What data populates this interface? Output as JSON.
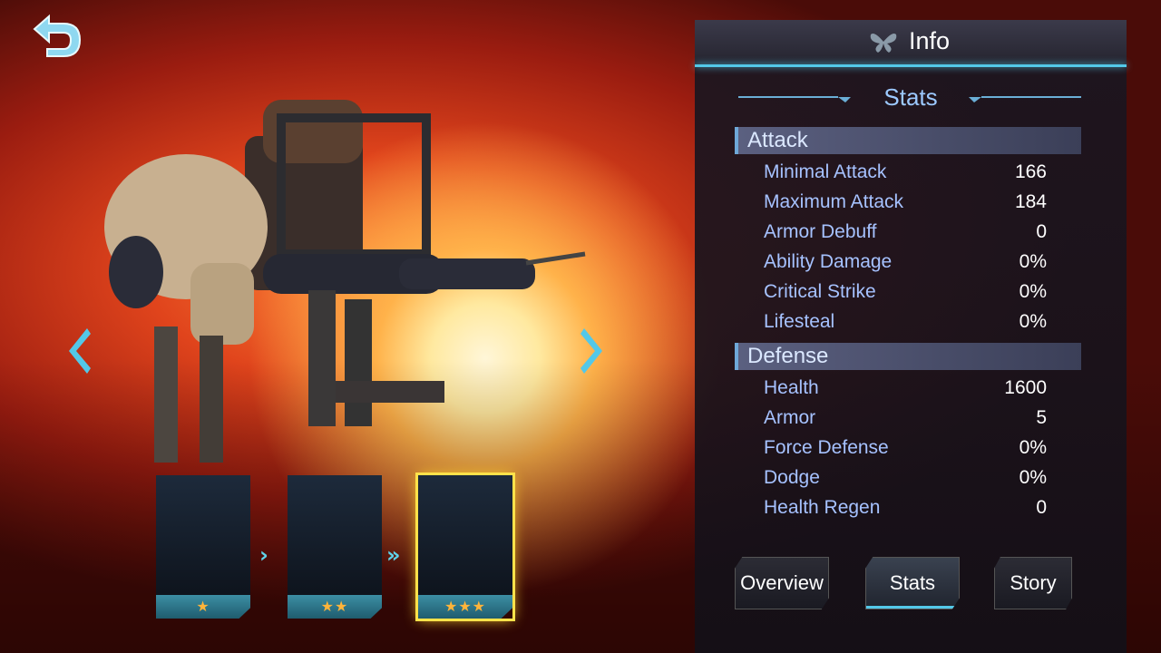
{
  "navigation": {
    "back_icon": "back-arrow-icon",
    "prev_icon": "chevron-left-icon",
    "next_icon": "chevron-right-icon"
  },
  "evolution": {
    "cards": [
      {
        "stars": "★",
        "selected": false
      },
      {
        "stars": "★★",
        "selected": false
      },
      {
        "stars": "★★★",
        "selected": true
      }
    ]
  },
  "panel": {
    "title": "Info",
    "title_icon": "butterfly-icon",
    "stats_heading": "Stats",
    "sections": [
      {
        "name": "Attack",
        "rows": [
          {
            "label": "Minimal Attack",
            "value": "166"
          },
          {
            "label": "Maximum Attack",
            "value": "184"
          },
          {
            "label": "Armor Debuff",
            "value": "0"
          },
          {
            "label": "Ability Damage",
            "value": "0%"
          },
          {
            "label": "Critical Strike",
            "value": "0%"
          },
          {
            "label": "Lifesteal",
            "value": "0%"
          }
        ]
      },
      {
        "name": "Defense",
        "rows": [
          {
            "label": "Health",
            "value": "1600"
          },
          {
            "label": "Armor",
            "value": "5"
          },
          {
            "label": "Force Defense",
            "value": "0%"
          },
          {
            "label": "Dodge",
            "value": "0%"
          },
          {
            "label": "Health Regen",
            "value": "0"
          }
        ]
      }
    ],
    "tabs": [
      {
        "label": "Overview",
        "active": false
      },
      {
        "label": "Stats",
        "active": true
      },
      {
        "label": "Story",
        "active": false
      }
    ]
  },
  "colors": {
    "accent": "#53c8e8",
    "label": "#a6c2ff",
    "value": "#ffffff",
    "star": "#ffb43a",
    "selected_outline": "#ffe24a"
  }
}
